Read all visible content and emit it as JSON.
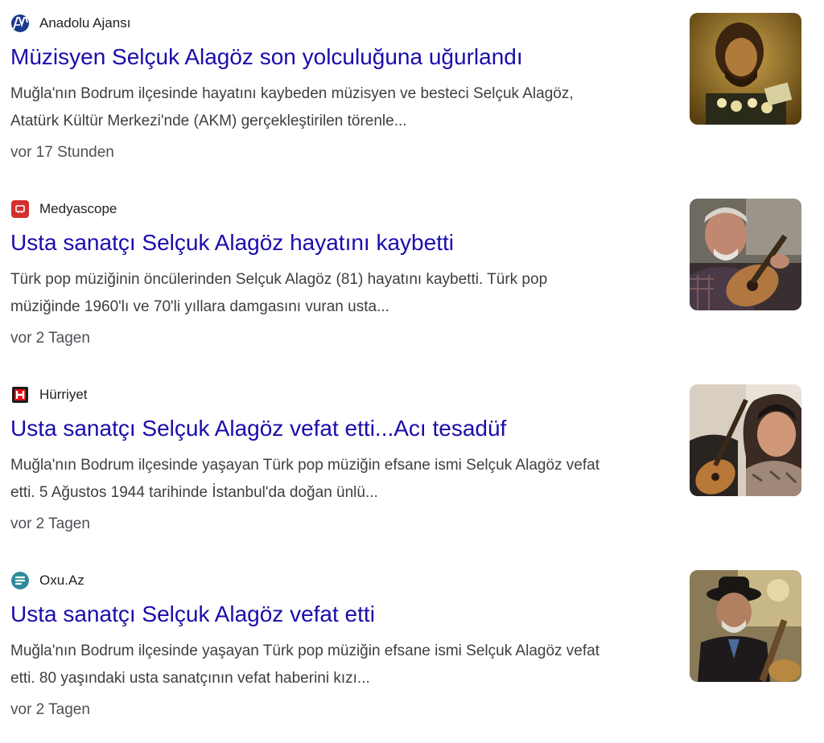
{
  "results": [
    {
      "source": "Anadolu Ajansı",
      "favicon": "anadolu-ajansi-logo-icon",
      "headline": "Müzisyen Selçuk Alagöz son yolculuğuna uğurlandı",
      "snippet_line1": "Muğla'nın Bodrum ilçesinde hayatını kaybeden müzisyen ve besteci Selçuk Alagöz,",
      "snippet_line2": "Atatürk Kültür Merkezi'nde (AKM) gerçekleştirilen törenle...",
      "time": "vor 17 Stunden",
      "thumbnail": "portrait-with-flowers-photo"
    },
    {
      "source": "Medyascope",
      "favicon": "medyascope-logo-icon",
      "headline": "Usta sanatçı Selçuk Alagöz hayatını kaybetti",
      "snippet_line1": "Türk pop müziğinin öncülerinden Selçuk Alagöz (81) hayatını kaybetti. Türk pop",
      "snippet_line2": "müziğinde 1960'lı ve 70'li yıllara damgasını vuran usta...",
      "time": "vor 2 Tagen",
      "thumbnail": "man-with-guitar-photo"
    },
    {
      "source": "Hürriyet",
      "favicon": "hurriyet-logo-icon",
      "headline": "Usta sanatçı Selçuk Alagöz vefat etti...Acı tesadüf",
      "snippet_line1": "Muğla'nın Bodrum ilçesinde yaşayan Türk pop müziğin efsane ismi Selçuk Alagöz vefat",
      "snippet_line2": "etti. 5 Ağustos 1944 tarihinde İstanbul'da doğan ünlü...",
      "time": "vor 2 Tagen",
      "thumbnail": "two-guitarists-photo"
    },
    {
      "source": "Oxu.Az",
      "favicon": "oxu-az-logo-icon",
      "headline": "Usta sanatçı Selçuk Alagöz vefat etti",
      "snippet_line1": "Muğla'nın Bodrum ilçesinde yaşayan Türk pop müziğin efsane ismi Selçuk Alagöz vefat",
      "snippet_line2": "etti. 80 yaşındaki usta sanatçının vefat haberini kızı...",
      "time": "vor 2 Tagen",
      "thumbnail": "man-in-hat-photo"
    }
  ],
  "colors": {
    "headline": "#1a0dab",
    "snippet": "#3c4043",
    "time": "#4d5156",
    "anadolu": "#1a3a8c",
    "medyascope": "#d32f2f",
    "hurriyet": "#e30613",
    "oxu": "#2e8b9a"
  }
}
